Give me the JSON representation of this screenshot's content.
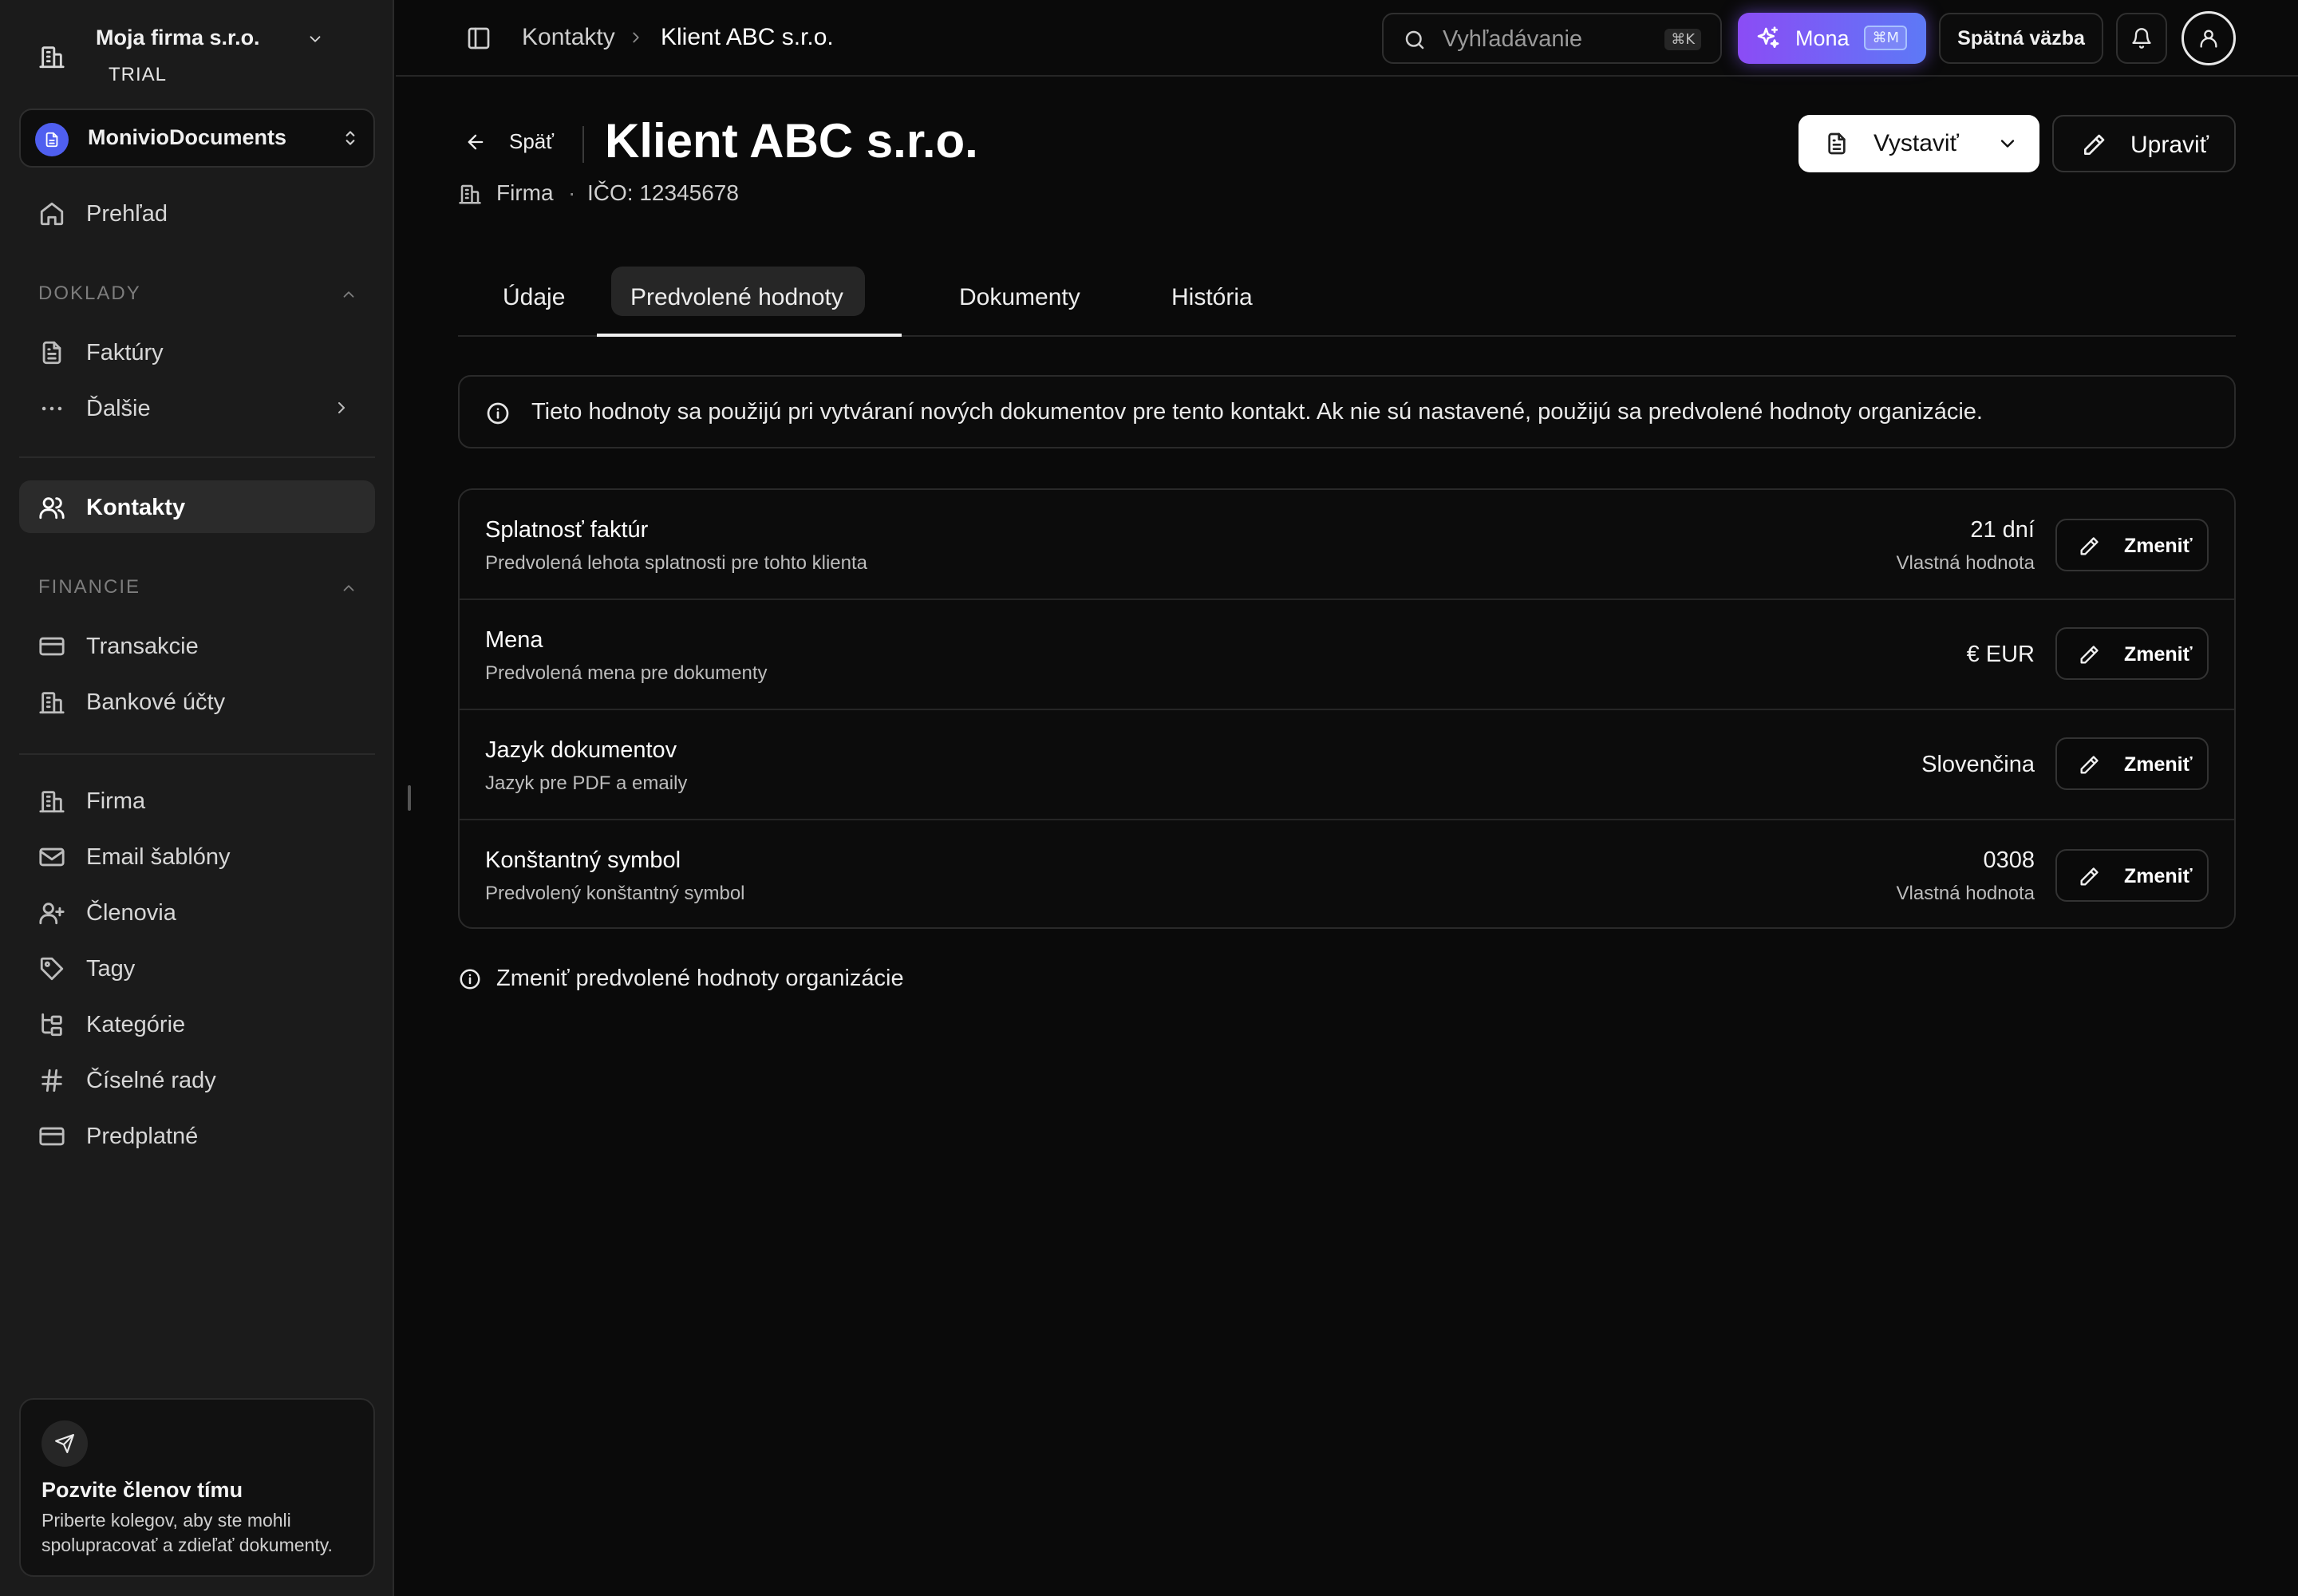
{
  "sidebar": {
    "org_name": "Moja firma s.r.o.",
    "org_plan": "TRIAL",
    "workspace_name": "MonivioDocuments",
    "overview": "Prehľad",
    "section_documents": "DOKLADY",
    "invoices": "Faktúry",
    "more": "Ďalšie",
    "contacts": "Kontakty",
    "section_finance": "FINANCIE",
    "transactions": "Transakcie",
    "bank_accounts": "Bankové účty",
    "company": "Firma",
    "email_templates": "Email šablóny",
    "members": "Členovia",
    "tags": "Tagy",
    "categories": "Kategórie",
    "number_series": "Číselné rady",
    "subscription": "Predplatné",
    "invite_title": "Pozvite členov tímu",
    "invite_desc": "Priberte kolegov, aby ste mohli spolupracovať a zdieľať dokumenty."
  },
  "topbar": {
    "breadcrumb_parent": "Kontakty",
    "breadcrumb_current": "Klient ABC s.r.o.",
    "search_placeholder": "Vyhľadávanie",
    "search_shortcut": "⌘K",
    "assistant_label": "Mona",
    "assistant_shortcut": "⌘M",
    "feedback_label": "Spätná väzba"
  },
  "header": {
    "back_label": "Späť",
    "title": "Klient ABC s.r.o.",
    "contact_type": "Firma",
    "ico": "IČO: 12345678",
    "issue_label": "Vystaviť",
    "edit_label": "Upraviť"
  },
  "tabs": [
    {
      "label": "Údaje"
    },
    {
      "label": "Predvolené hodnoty"
    },
    {
      "label": "Dokumenty"
    },
    {
      "label": "História"
    }
  ],
  "info_text": "Tieto hodnoty sa použijú pri vytváraní nových dokumentov pre tento kontakt. Ak nie sú nastavené, použijú sa predvolené hodnoty organizácie.",
  "settings": [
    {
      "title": "Splatnosť faktúr",
      "desc": "Predvolená lehota splatnosti pre tohto klienta",
      "value": "21 dní",
      "sub": "Vlastná hodnota",
      "button": "Zmeniť"
    },
    {
      "title": "Mena",
      "desc": "Predvolená mena pre dokumenty",
      "value": "€ EUR",
      "sub": "",
      "button": "Zmeniť"
    },
    {
      "title": "Jazyk dokumentov",
      "desc": "Jazyk pre PDF a emaily",
      "value": "Slovenčina",
      "sub": "",
      "button": "Zmeniť"
    },
    {
      "title": "Konštantný symbol",
      "desc": "Predvolený konštantný symbol",
      "value": "0308",
      "sub": "Vlastná hodnota",
      "button": "Zmeniť"
    }
  ],
  "org_defaults_link": "Zmeniť predvolené hodnoty organizácie",
  "colors": {
    "accent_start": "#8b4cf5",
    "accent_end": "#5d79f6",
    "workspace_logo": "#4f5ff0"
  }
}
